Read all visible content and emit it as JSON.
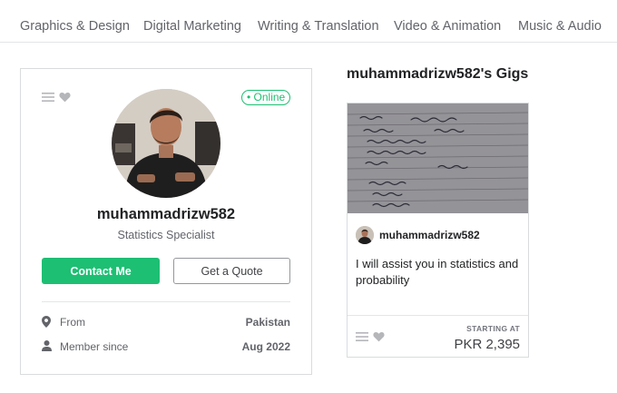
{
  "nav": {
    "categories": [
      "Graphics & Design",
      "Digital Marketing",
      "Writing & Translation",
      "Video & Animation",
      "Music & Audio"
    ]
  },
  "profile": {
    "online_label": "Online",
    "username": "muhammadrizw582",
    "title": "Statistics Specialist",
    "contact_label": "Contact Me",
    "quote_label": "Get a Quote",
    "from_label": "From",
    "from_value": "Pakistan",
    "member_label": "Member since",
    "member_value": "Aug 2022"
  },
  "gigs": {
    "heading": "muhammadrizw582's Gigs",
    "items": [
      {
        "seller": "muhammadrizw582",
        "title": "I will assist you in statistics and probability",
        "starting_label": "STARTING AT",
        "price": "PKR 2,395"
      }
    ]
  },
  "colors": {
    "accent": "#1dbf73",
    "text_dark": "#222325",
    "text_muted": "#62646a",
    "border": "#dadbdd"
  },
  "icons": [
    "menu-icon",
    "heart-icon",
    "location-pin-icon",
    "user-icon"
  ]
}
